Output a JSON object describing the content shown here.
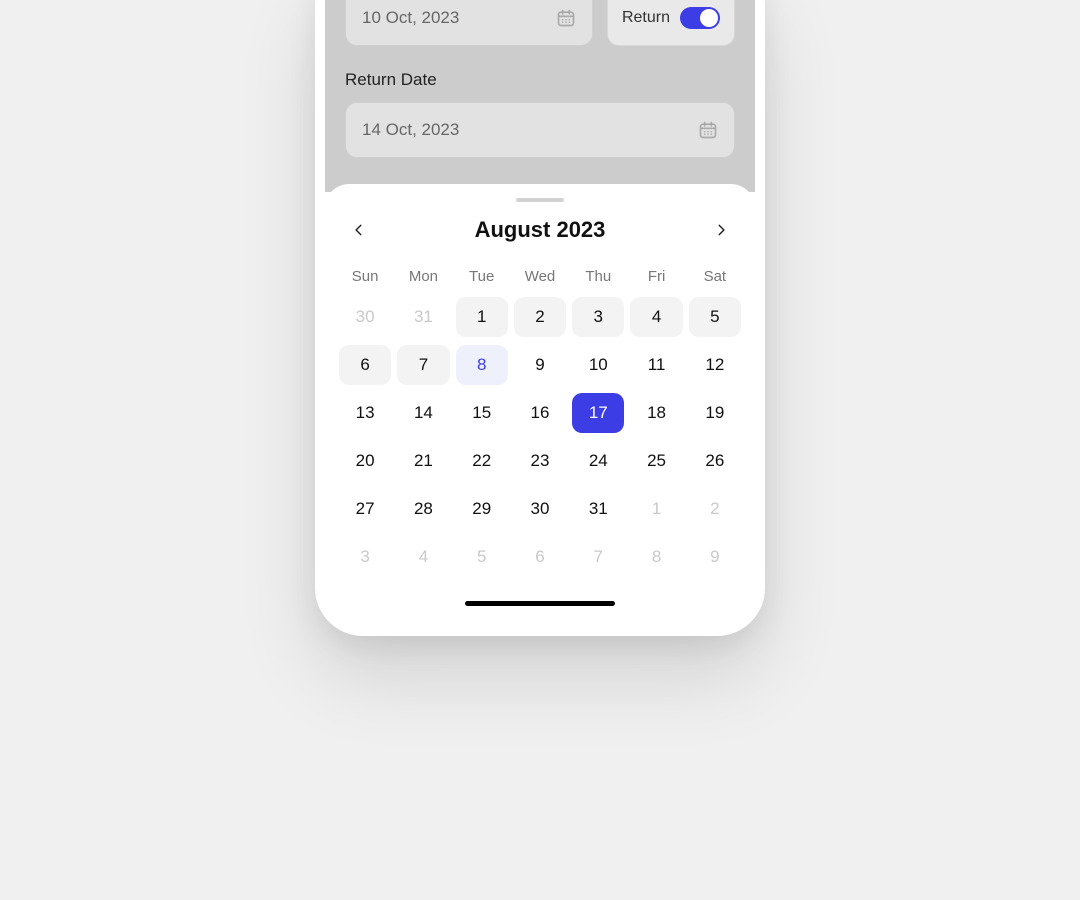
{
  "accent": "#3d3de6",
  "form": {
    "depart_date_value": "10 Oct, 2023",
    "return_toggle_label": "Return",
    "return_toggle_on": true,
    "return_date_label": "Return Date",
    "return_date_value": "14 Oct, 2023"
  },
  "calendar": {
    "month_title": "August 2023",
    "days_of_week": [
      "Sun",
      "Mon",
      "Tue",
      "Wed",
      "Thu",
      "Fri",
      "Sat"
    ],
    "weeks": [
      [
        {
          "d": "30",
          "state": "other"
        },
        {
          "d": "31",
          "state": "other"
        },
        {
          "d": "1",
          "state": "boxed"
        },
        {
          "d": "2",
          "state": "boxed"
        },
        {
          "d": "3",
          "state": "boxed"
        },
        {
          "d": "4",
          "state": "boxed"
        },
        {
          "d": "5",
          "state": "boxed"
        }
      ],
      [
        {
          "d": "6",
          "state": "boxed"
        },
        {
          "d": "7",
          "state": "boxed"
        },
        {
          "d": "8",
          "state": "highlight"
        },
        {
          "d": "9",
          "state": ""
        },
        {
          "d": "10",
          "state": ""
        },
        {
          "d": "11",
          "state": ""
        },
        {
          "d": "12",
          "state": ""
        }
      ],
      [
        {
          "d": "13",
          "state": ""
        },
        {
          "d": "14",
          "state": ""
        },
        {
          "d": "15",
          "state": ""
        },
        {
          "d": "16",
          "state": ""
        },
        {
          "d": "17",
          "state": "selected"
        },
        {
          "d": "18",
          "state": ""
        },
        {
          "d": "19",
          "state": ""
        }
      ],
      [
        {
          "d": "20",
          "state": ""
        },
        {
          "d": "21",
          "state": ""
        },
        {
          "d": "22",
          "state": ""
        },
        {
          "d": "23",
          "state": ""
        },
        {
          "d": "24",
          "state": ""
        },
        {
          "d": "25",
          "state": ""
        },
        {
          "d": "26",
          "state": ""
        }
      ],
      [
        {
          "d": "27",
          "state": ""
        },
        {
          "d": "28",
          "state": ""
        },
        {
          "d": "29",
          "state": ""
        },
        {
          "d": "30",
          "state": ""
        },
        {
          "d": "31",
          "state": ""
        },
        {
          "d": "1",
          "state": "other"
        },
        {
          "d": "2",
          "state": "other"
        }
      ],
      [
        {
          "d": "3",
          "state": "other"
        },
        {
          "d": "4",
          "state": "other"
        },
        {
          "d": "5",
          "state": "other"
        },
        {
          "d": "6",
          "state": "other"
        },
        {
          "d": "7",
          "state": "other"
        },
        {
          "d": "8",
          "state": "other"
        },
        {
          "d": "9",
          "state": "other"
        }
      ]
    ]
  }
}
